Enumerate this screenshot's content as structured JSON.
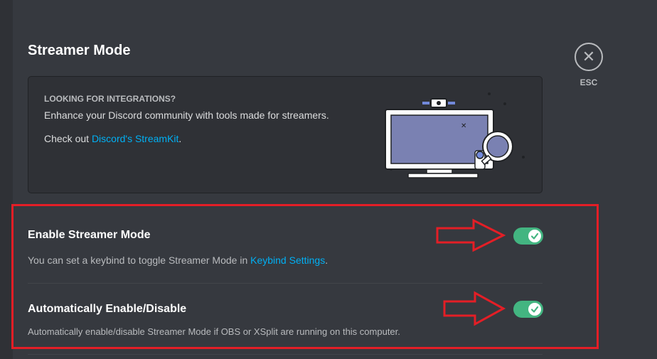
{
  "header": {
    "title": "Streamer Mode"
  },
  "close": {
    "label": "ESC",
    "icon": "close-icon"
  },
  "promo": {
    "heading": "LOOKING FOR INTEGRATIONS?",
    "text": "Enhance your Discord community with tools made for streamers.",
    "link_prefix": "Check out ",
    "link_text": "Discord's StreamKit",
    "link_suffix": "."
  },
  "settings": [
    {
      "title": "Enable Streamer Mode",
      "desc_prefix": "You can set a keybind to toggle Streamer Mode in ",
      "desc_link": "Keybind Settings",
      "desc_suffix": ".",
      "enabled": true
    },
    {
      "title": "Automatically Enable/Disable",
      "desc": "Automatically enable/disable Streamer Mode if OBS or XSplit are running on this computer.",
      "enabled": true
    }
  ],
  "colors": {
    "background": "#36393f",
    "card": "#2f3136",
    "toggle_on": "#43b581",
    "link": "#00b0f4",
    "annotation": "#e41e26"
  }
}
